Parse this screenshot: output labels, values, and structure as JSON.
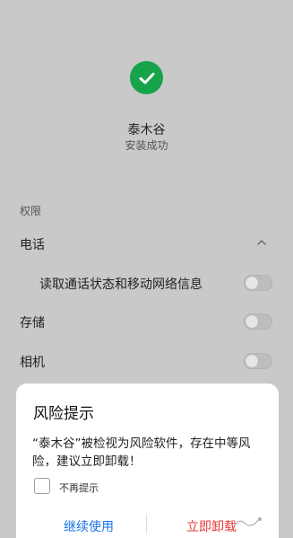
{
  "app": {
    "name": "泰木谷",
    "install_status": "安装成功"
  },
  "permissions": {
    "section_title": "权限",
    "items": [
      {
        "label": "电话",
        "expanded": true
      },
      {
        "label": "读取通话状态和移动网络信息",
        "enabled": false
      },
      {
        "label": "存储",
        "enabled": false
      },
      {
        "label": "相机",
        "enabled": false
      }
    ]
  },
  "dialog": {
    "title": "风险提示",
    "message": "“泰木谷”被检视为风险软件，存在中等风险，建议立即卸载！",
    "checkbox_label": "不再提示",
    "checkbox_checked": false,
    "continue_label": "继续使用",
    "uninstall_label": "立即卸载"
  },
  "colors": {
    "success": "#16a34a",
    "continue": "#1a73e8",
    "uninstall": "#e53935",
    "overlay_bg": "#c9c9c9"
  },
  "icons": [
    "check-icon",
    "chevron-up-icon"
  ]
}
